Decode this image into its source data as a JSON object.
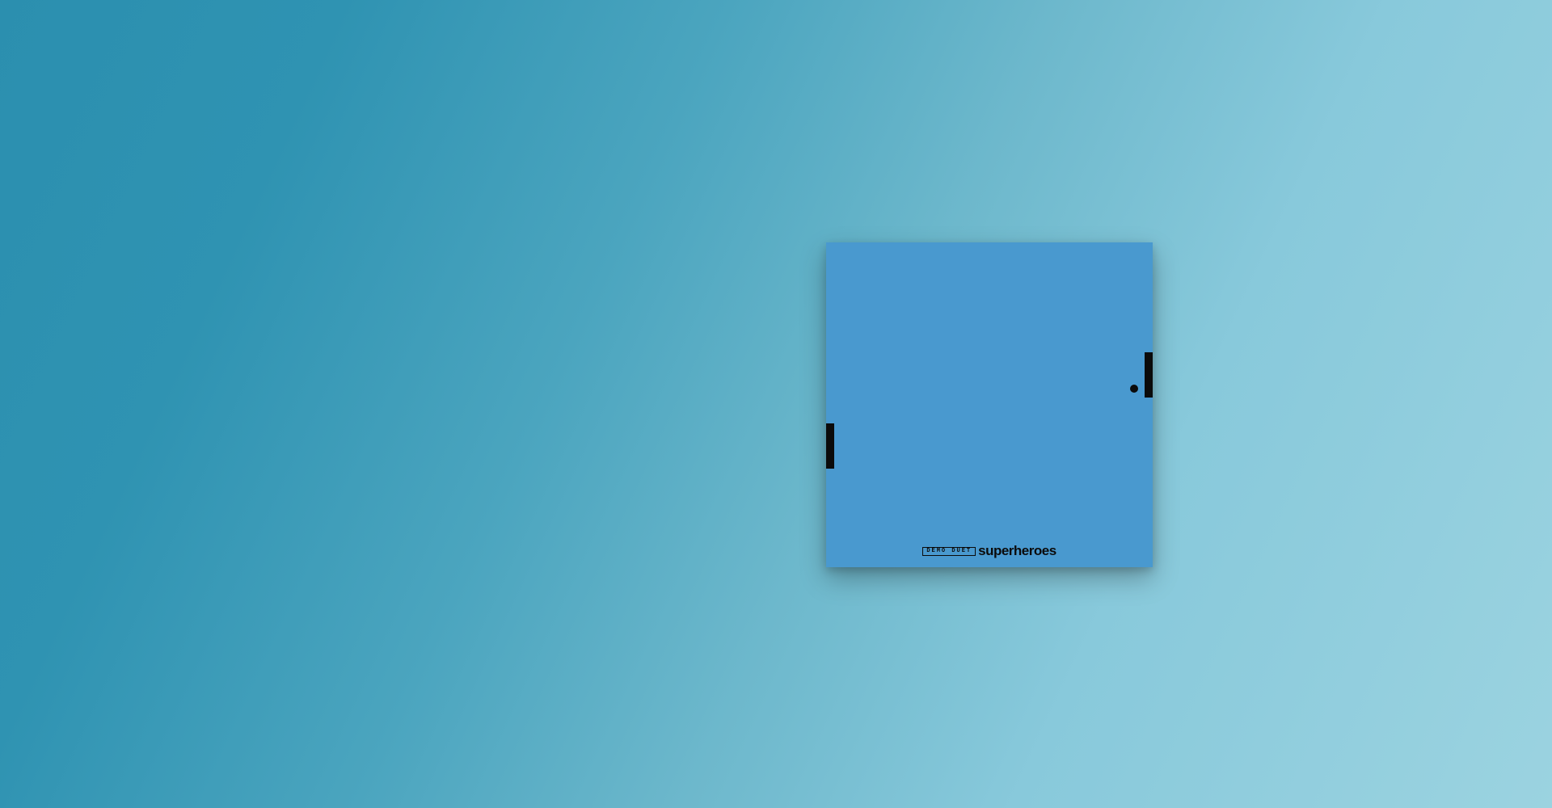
{
  "game": {
    "type": "pong",
    "board_color": "#4999cf",
    "piece_color": "#0b0b0b",
    "background_gradient": [
      "#2b8faf",
      "#9bd3e0"
    ]
  },
  "brand": {
    "tag": "DEMO DUET",
    "name": "superheroes"
  }
}
